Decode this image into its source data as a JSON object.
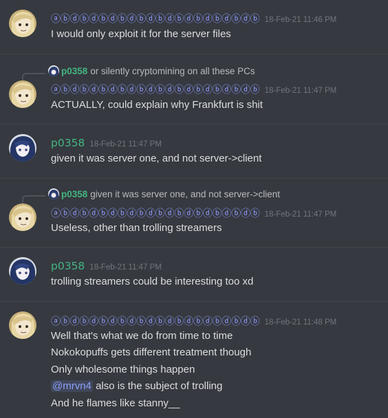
{
  "messages": [
    {
      "author": "ⓐⓑⓓⓑⓓⓑⓓⓑⓓⓑⓓⓑⓓⓑⓓⓑⓓⓑⓓⓑⓓⓑ",
      "timestamp": "18-Feb-21 11:46 PM",
      "lines": [
        "I would only exploit it for the server files"
      ]
    },
    {
      "reply": {
        "author": "p0358",
        "text": "or silently cryptomining on all these PCs"
      },
      "author": "ⓐⓑⓓⓑⓓⓑⓓⓑⓓⓑⓓⓑⓓⓑⓓⓑⓓⓑⓓⓑⓓⓑ",
      "timestamp": "18-Feb-21 11:47 PM",
      "lines": [
        "ACTUALLY, could explain why Frankfurt is shit"
      ]
    },
    {
      "author": "p0358",
      "timestamp": "18-Feb-21 11:47 PM",
      "lines": [
        "given it was server one, and not server->client"
      ]
    },
    {
      "reply": {
        "author": "p0358",
        "text": "given it was server one, and not server->client"
      },
      "author": "ⓐⓑⓓⓑⓓⓑⓓⓑⓓⓑⓓⓑⓓⓑⓓⓑⓓⓑⓓⓑⓓⓑ",
      "timestamp": "18-Feb-21 11:47 PM",
      "lines": [
        "Useless, other than trolling streamers"
      ]
    },
    {
      "author": "p0358",
      "timestamp": "18-Feb-21 11:47 PM",
      "lines": [
        "trolling streamers could be interesting too xd"
      ]
    },
    {
      "author": "ⓐⓑⓓⓑⓓⓑⓓⓑⓓⓑⓓⓑⓓⓑⓓⓑⓓⓑⓓⓑⓓⓑ",
      "timestamp": "18-Feb-21 11:48 PM",
      "lines": [
        "Well that's what we do from time to time",
        "Nokokopuffs gets different treatment though",
        "Only wholesome things happen",
        "also is the subject of trolling",
        "And he flames like stanny__"
      ],
      "mention": "@mrvn4"
    }
  ],
  "colors": {
    "background": "#36393f",
    "sigil_name": "#8f9bff",
    "green_name": "#43b581",
    "timestamp": "#72767d",
    "text": "#dcddde",
    "mention": "#8a9ffb"
  },
  "icons": {
    "anime_avatar": "avatar-icon",
    "dark_avatar": "avatar-icon",
    "mini_avatar": "mini-avatar-icon"
  }
}
